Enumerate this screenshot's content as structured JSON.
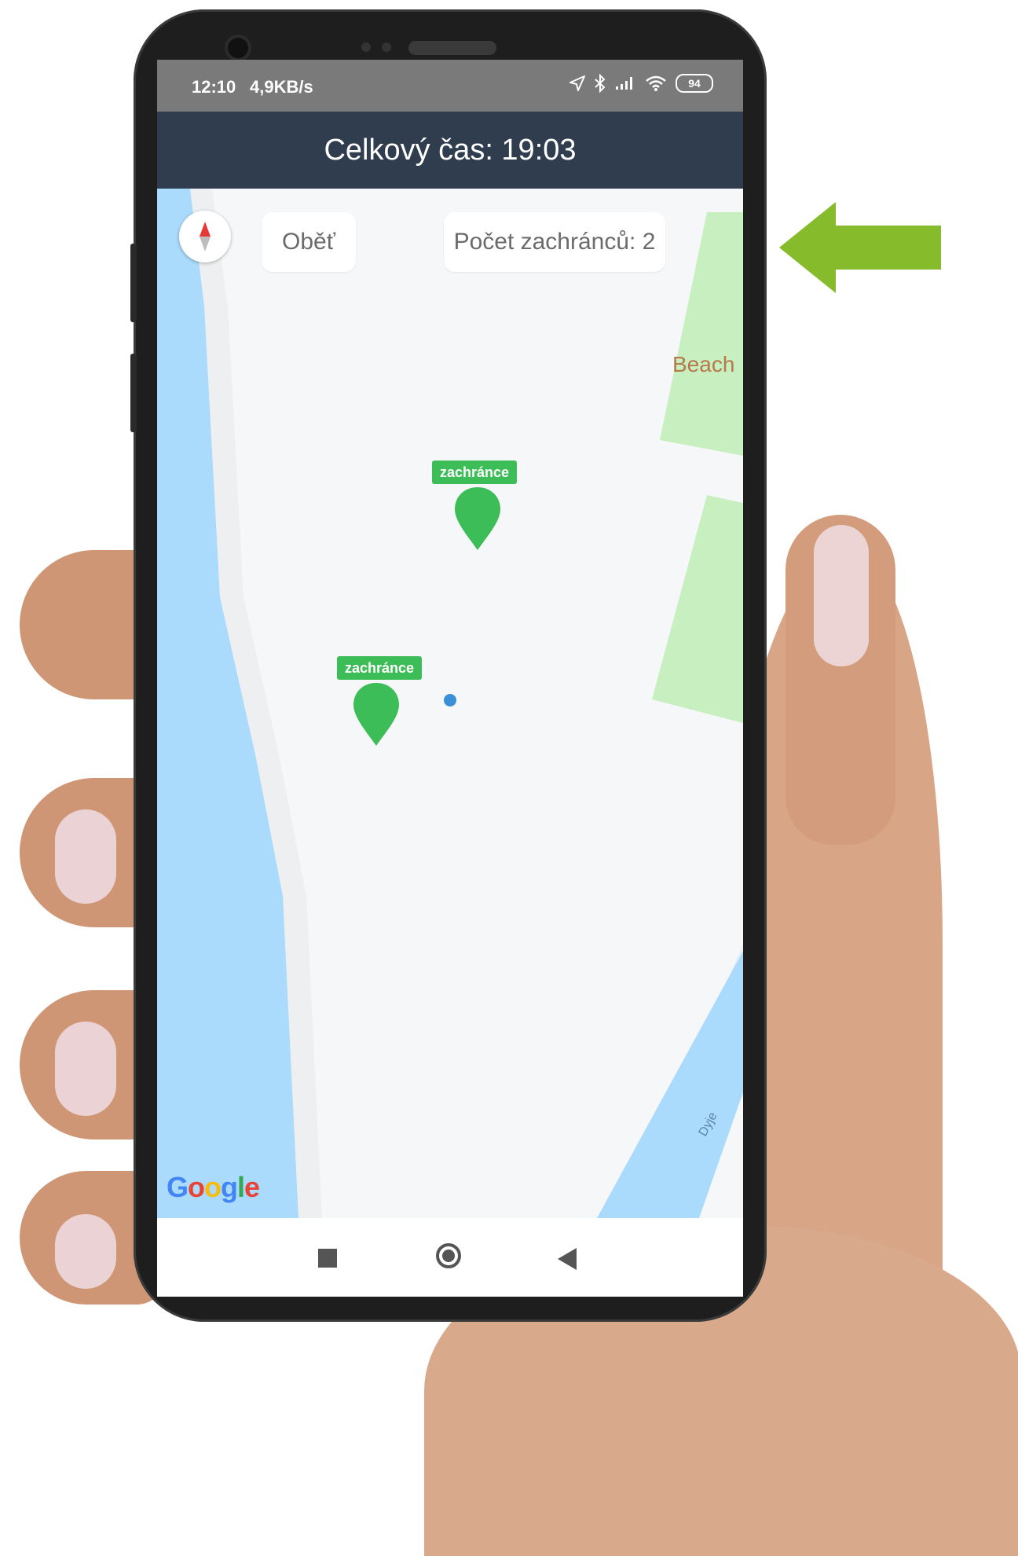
{
  "status_bar": {
    "time": "12:10",
    "speed": "4,9KB/s",
    "battery": "94"
  },
  "header": {
    "title": "Celkový čas: 19:03"
  },
  "map": {
    "victim_button_label": "Oběť",
    "rescuer_count_label": "Počet zachránců: 2",
    "place_label": "Beach",
    "river_label": "Dyje",
    "markers": [
      {
        "label": "zachránce"
      },
      {
        "label": "zachránce"
      }
    ],
    "attribution": {
      "letters": [
        "G",
        "o",
        "o",
        "g",
        "l",
        "e"
      ],
      "colors": [
        "#4285F4",
        "#EA4335",
        "#FBBC05",
        "#4285F4",
        "#34A853",
        "#EA4335"
      ]
    }
  },
  "navigation_bar": {
    "buttons": [
      "recent-apps",
      "home",
      "back"
    ]
  },
  "colors": {
    "header_bg": "#2f3d4e",
    "marker": "#3dbd57",
    "water": "#aadafc",
    "park": "#c8efc0",
    "arrow": "#86bc2b",
    "my_location": "#3b8fd9"
  }
}
